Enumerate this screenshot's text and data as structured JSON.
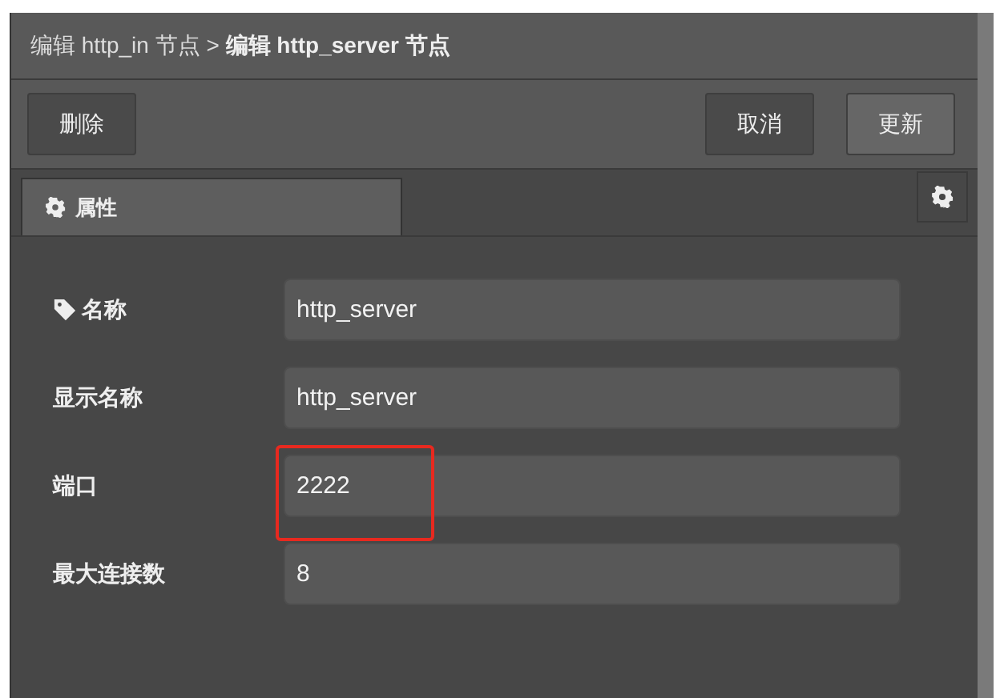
{
  "header": {
    "breadcrumb": "编辑 http_in 节点 > **编辑 http_server 节点**"
  },
  "toolbar": {
    "left_buttons": [
      {
        "label": "删除",
        "primary": false
      }
    ],
    "right_buttons": [
      {
        "label": "取消",
        "primary": false
      },
      {
        "label": "更新",
        "primary": true
      }
    ]
  },
  "tabs": [
    {
      "label": "属性",
      "selected": true
    }
  ],
  "fields": [
    {
      "label": "名称",
      "has_icon": true,
      "value": "http_server",
      "highlighted": false
    },
    {
      "label": "显示名称",
      "has_icon": false,
      "value": "http_server",
      "highlighted": false
    },
    {
      "label": "端口",
      "has_icon": false,
      "value": "2222",
      "highlighted": true
    },
    {
      "label": "最大连接数",
      "has_icon": false,
      "value": "8",
      "highlighted": false
    }
  ]
}
